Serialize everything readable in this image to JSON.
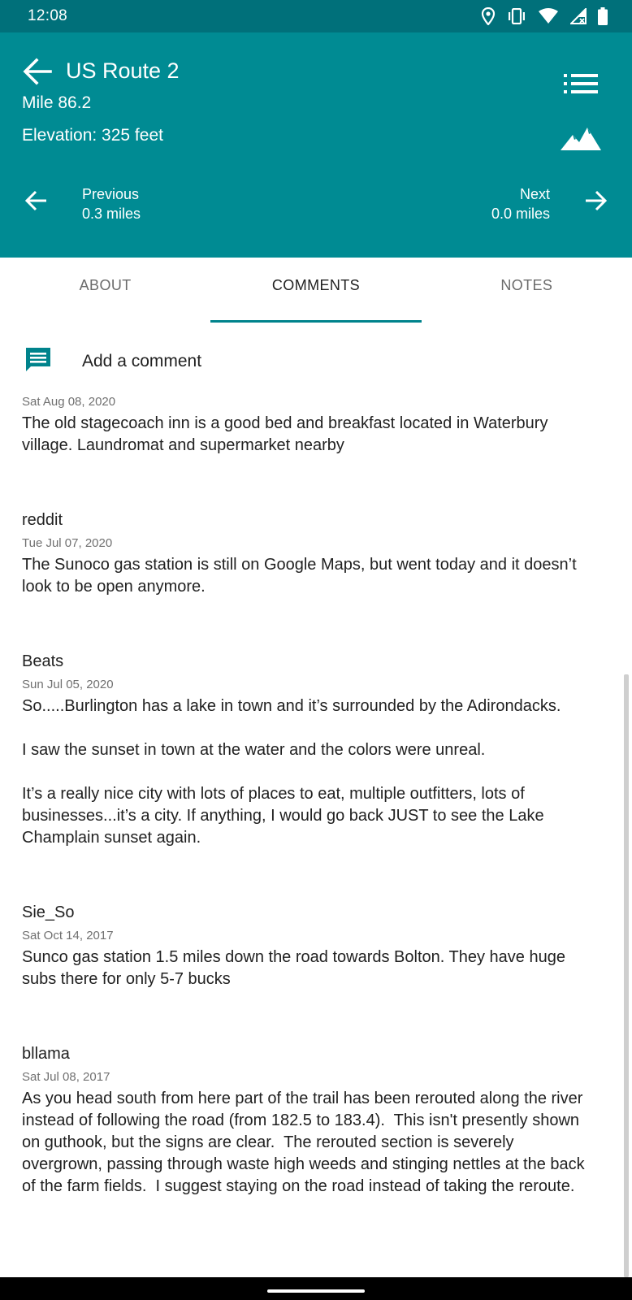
{
  "status_bar": {
    "time": "12:08",
    "icons": [
      "location-icon",
      "vibrate-icon",
      "wifi-icon",
      "signal-icon",
      "battery-icon"
    ]
  },
  "header": {
    "title": "US Route 2",
    "mile": "Mile 86.2",
    "elevation": "Elevation: 325 feet",
    "previous_label": "Previous",
    "previous_distance": "0.3 miles",
    "next_label": "Next",
    "next_distance": "0.0 miles"
  },
  "tabs": [
    {
      "label": "ABOUT",
      "active": false
    },
    {
      "label": "COMMENTS",
      "active": true
    },
    {
      "label": "NOTES",
      "active": false
    }
  ],
  "add_comment": {
    "label": "Add a comment"
  },
  "comments": [
    {
      "author": "",
      "date": "Sat Aug 08, 2020",
      "body": "The old stagecoach inn is a good bed and breakfast located in Waterbury village. Laundromat and supermarket nearby"
    },
    {
      "author": "reddit",
      "date": "Tue Jul 07, 2020",
      "body": "The Sunoco gas station is still on Google Maps, but went today and it doesn’t look to be open anymore."
    },
    {
      "author": "Beats",
      "date": "Sun Jul 05, 2020",
      "body": "So.....Burlington has a lake in town and it’s surrounded by the Adirondacks.\n\nI saw the sunset in town at the water and the colors were unreal.\n\nIt’s a really nice city with lots of places to eat, multiple outfitters, lots of businesses...it’s a city. If anything, I would go back JUST to see the Lake Champlain sunset again."
    },
    {
      "author": "Sie_So",
      "date": "Sat Oct 14, 2017",
      "body": "Sunco gas station 1.5 miles down the road towards Bolton. They have huge subs there for only 5-7 bucks"
    },
    {
      "author": "bllama",
      "date": "Sat Jul 08, 2017",
      "body": "As you head south from here part of the trail has been rerouted along the river instead of following the road (from 182.5 to 183.4).  This isn't presently shown on guthook, but the signs are clear.  The rerouted section is severely overgrown, passing through waste high weeds and stinging nettles at the back of the farm fields.  I suggest staying on the road instead of taking the reroute."
    }
  ],
  "colors": {
    "header": "#008b93",
    "status_bar": "#00707a",
    "accent": "#00838c"
  }
}
